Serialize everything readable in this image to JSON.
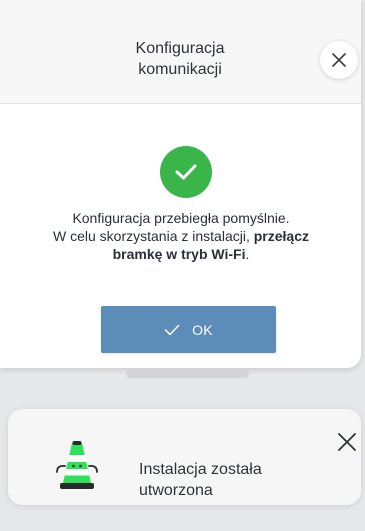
{
  "dialog": {
    "title_line1": "Konfiguracja",
    "title_line2": "komunikacji",
    "message_line1": "Konfiguracja przebiegła pomyślnie.",
    "message_line2_normal": "W celu skorzystania z instalacji, ",
    "message_line2_bold": "przełącz",
    "message_line3_bold": "bramkę w tryb Wi-Fi",
    "message_line3_end": ".",
    "ok_label": "OK",
    "accent_color": "#5b8db8",
    "success_color": "#3ab54a",
    "icons": [
      "close-icon",
      "success-check-icon",
      "checkmark-icon"
    ]
  },
  "notification": {
    "text_line1": "Instalacja została",
    "text_line2": "utworzona",
    "icons": [
      "traffic-cone-icon",
      "close-icon"
    ]
  }
}
